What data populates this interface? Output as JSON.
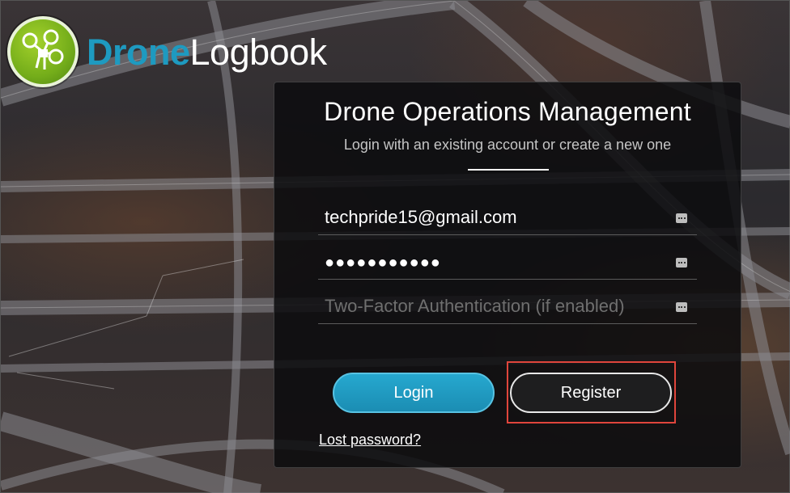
{
  "logo": {
    "brand_part1": "Drone",
    "brand_part2": "Logbook",
    "icon": "drone-icon"
  },
  "panel": {
    "title": "Drone Operations Management",
    "subtitle": "Login with an existing account or create a new one"
  },
  "form": {
    "email": {
      "value": "techpride15@gmail.com",
      "icon": "ellipsis-icon"
    },
    "password": {
      "value": "●●●●●●●●●●●",
      "icon": "ellipsis-icon"
    },
    "twofactor": {
      "placeholder": "Two-Factor Authentication (if enabled)",
      "icon": "ellipsis-icon"
    }
  },
  "buttons": {
    "login_label": "Login",
    "register_label": "Register"
  },
  "links": {
    "lost_password": "Lost password?"
  },
  "colors": {
    "accent_blue": "#1e9ac0",
    "brand_green": "#74ad1a",
    "highlight_red": "#e0453c"
  }
}
